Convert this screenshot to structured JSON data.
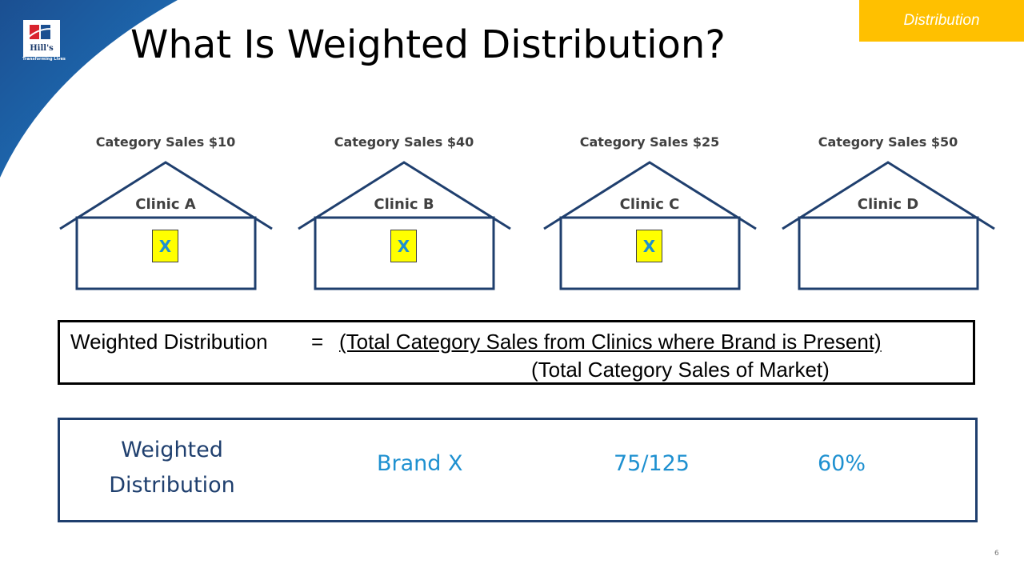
{
  "logo": {
    "brand": "Hill's",
    "tagline": "Transforming Lives"
  },
  "title": "What Is Weighted Distribution?",
  "section_tag": "Distribution",
  "clinics": [
    {
      "category_sales": "Category Sales $10",
      "name": "Clinic A",
      "brand_present": true,
      "mark": "X"
    },
    {
      "category_sales": "Category Sales $40",
      "name": "Clinic B",
      "brand_present": true,
      "mark": "X"
    },
    {
      "category_sales": "Category Sales $25",
      "name": "Clinic C",
      "brand_present": true,
      "mark": "X"
    },
    {
      "category_sales": "Category Sales $50",
      "name": "Clinic D",
      "brand_present": false,
      "mark": ""
    }
  ],
  "formula": {
    "label": "Weighted Distribution",
    "equals": "=",
    "numerator": "(Total Category Sales from Clinics where Brand is Present)",
    "denominator": "(Total Category Sales of Market)"
  },
  "result": {
    "label_line1": "Weighted",
    "label_line2": "Distribution",
    "brand": "Brand X",
    "fraction": "75/125",
    "percent": "60%"
  },
  "colors": {
    "navy": "#1f3f6e",
    "accent_blue": "#1e90d0",
    "yellow_tag": "#ffc000",
    "marker_yellow": "#ffff00"
  },
  "page_number": "6"
}
